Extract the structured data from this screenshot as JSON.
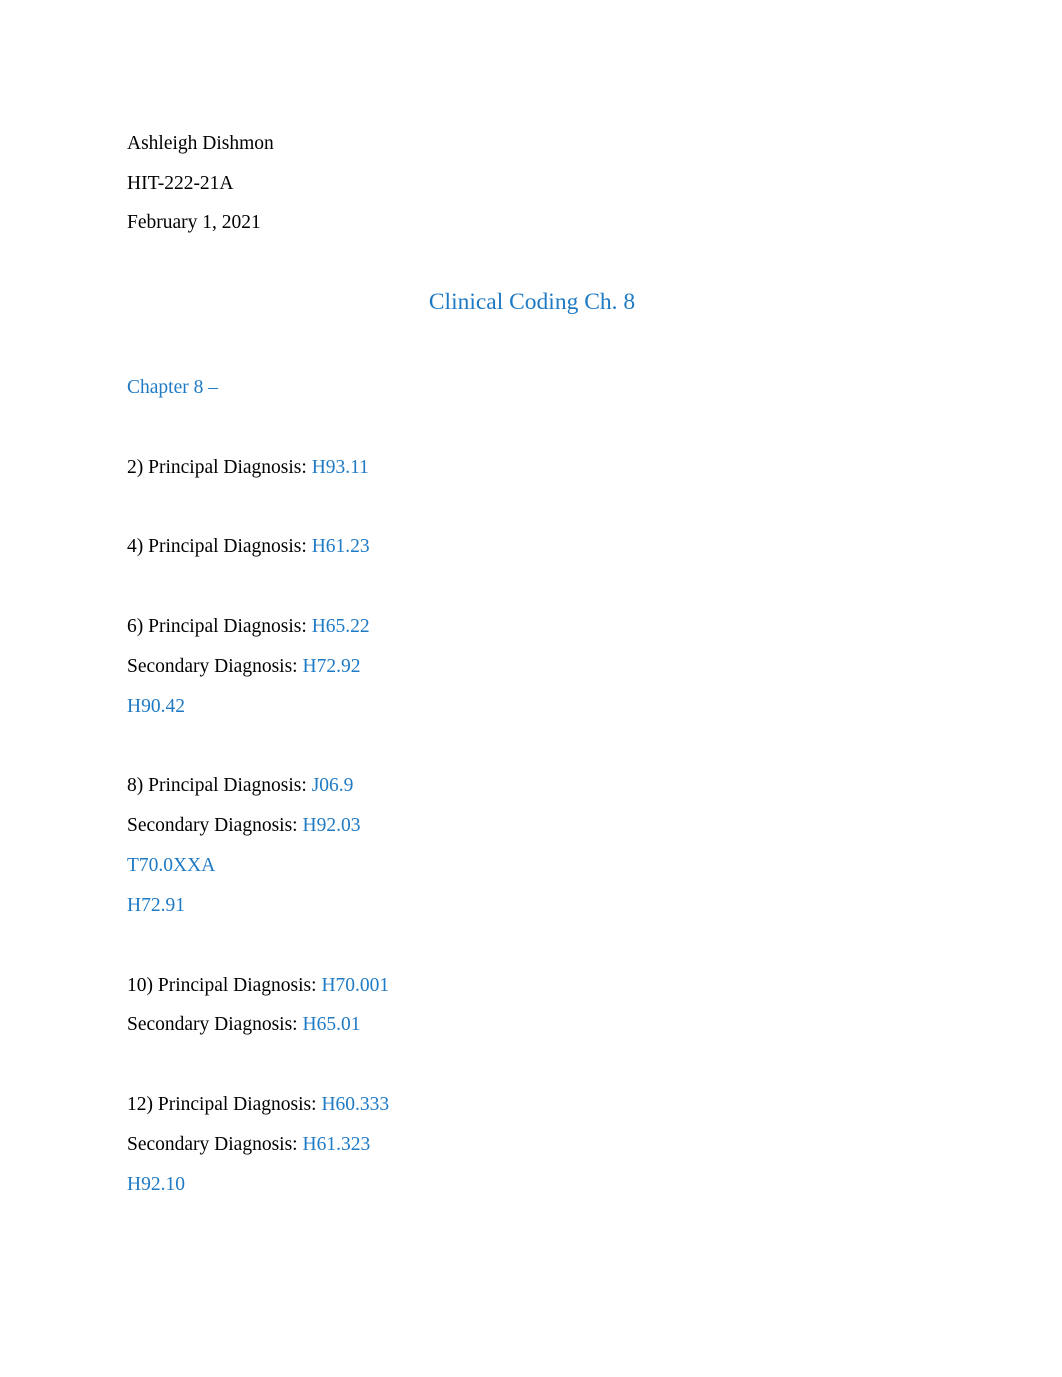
{
  "document": {
    "page_background": "#ffffff",
    "accent_color": "#1f7ac4",
    "text_color": "#000000",
    "header": {
      "author": "Ashleigh Dishmon",
      "course": "HIT-222-21A",
      "date": "February 1, 2021"
    },
    "title": "Clinical Coding Ch. 8",
    "section_heading": "Chapter 8 –",
    "labels": {
      "principal": "Principal Diagnosis:",
      "secondary": "Secondary Diagnosis:"
    },
    "answers": [
      {
        "number": "2)",
        "principal_label": "2) Principal Diagnosis:",
        "principal_code": "H93.11",
        "secondary_label": null,
        "secondary_code": null,
        "extra_codes": []
      },
      {
        "number": "4)",
        "principal_label": "4) Principal Diagnosis:",
        "principal_code": "H61.23",
        "secondary_label": null,
        "secondary_code": null,
        "extra_codes": []
      },
      {
        "number": "6)",
        "principal_label": "6) Principal Diagnosis:",
        "principal_code": "H65.22",
        "secondary_label": "Secondary Diagnosis:",
        "secondary_code": "H72.92",
        "extra_codes": [
          "H90.42"
        ]
      },
      {
        "number": "8)",
        "principal_label": "8) Principal Diagnosis:",
        "principal_code": "J06.9",
        "secondary_label": "Secondary Diagnosis:",
        "secondary_code": "H92.03",
        "extra_codes": [
          "T70.0XXA",
          "H72.91"
        ]
      },
      {
        "number": "10)",
        "principal_label": "10) Principal Diagnosis:",
        "principal_code": "H70.001",
        "secondary_label": "Secondary Diagnosis:",
        "secondary_code": "H65.01",
        "extra_codes": []
      },
      {
        "number": "12)",
        "principal_label": "12) Principal Diagnosis:",
        "principal_code": "H60.333",
        "secondary_label": "Secondary Diagnosis:",
        "secondary_code": "H61.323",
        "extra_codes": [
          "H92.10"
        ]
      }
    ]
  }
}
